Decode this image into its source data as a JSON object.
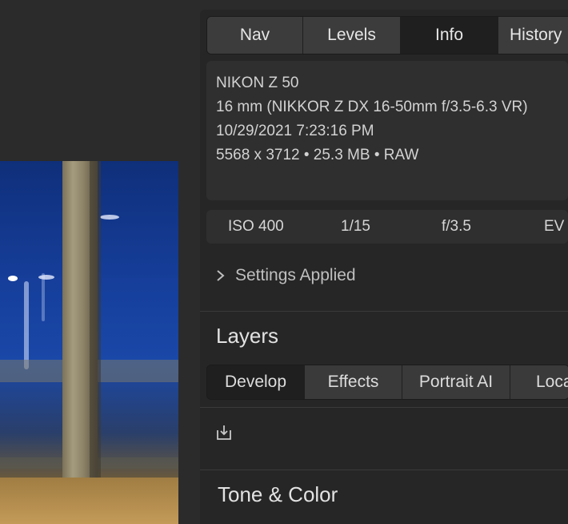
{
  "panel_tabs": [
    {
      "label": "Nav",
      "active": false
    },
    {
      "label": "Levels",
      "active": false
    },
    {
      "label": "Info",
      "active": true
    },
    {
      "label": "History",
      "active": false
    }
  ],
  "info": {
    "camera": "NIKON Z 50",
    "lens": "16 mm (NIKKOR Z DX 16-50mm f/3.5-6.3 VR)",
    "datetime": "10/29/2021 7:23:16 PM",
    "dims_line": "5568 x 3712 • 25.3 MB • RAW"
  },
  "exif": {
    "iso": "ISO 400",
    "shutter": "1/15",
    "aperture": "f/3.5",
    "ev": "EV"
  },
  "settings_applied": "Settings Applied",
  "layers": {
    "title": "Layers",
    "tabs": [
      {
        "label": "Develop",
        "active": true
      },
      {
        "label": "Effects",
        "active": false
      },
      {
        "label": "Portrait AI",
        "active": false
      },
      {
        "label": "Local",
        "active": false
      }
    ]
  },
  "tone_color_title": "Tone & Color",
  "colors": {
    "panel_bg": "#262626",
    "active_tab": "#1f1f1f",
    "inactive_tab": "#3c3c3c",
    "text": "#d7d7d7"
  },
  "icons": {
    "chevron": "chevron-right-icon",
    "import": "import-icon"
  }
}
